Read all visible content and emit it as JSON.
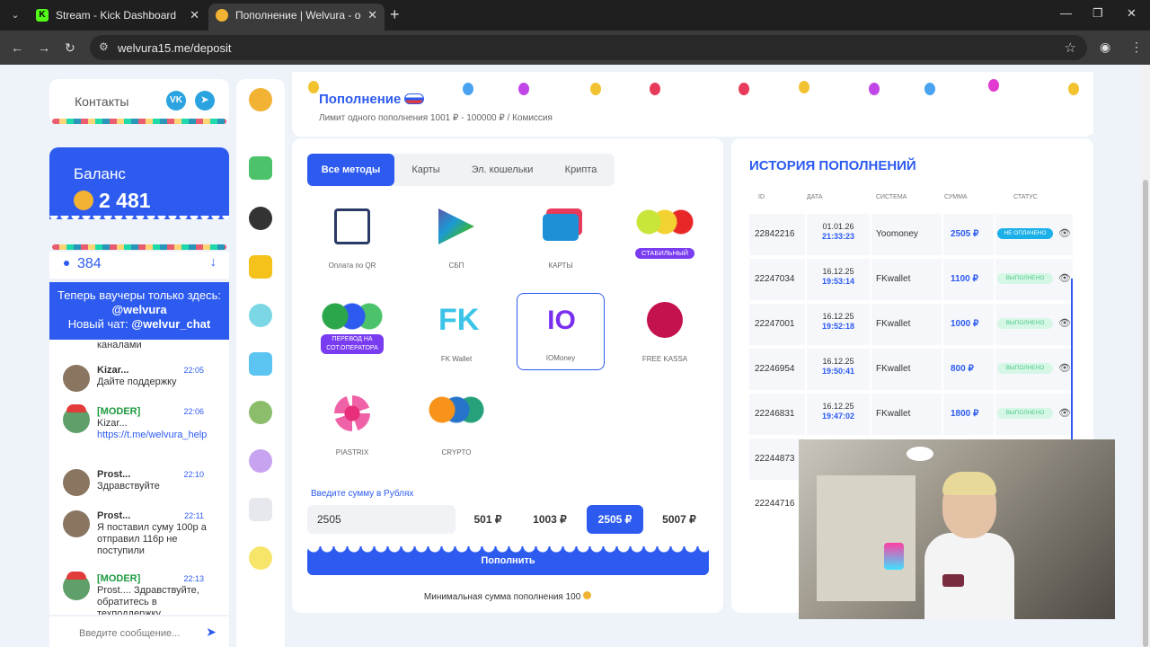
{
  "browser": {
    "tabs": [
      {
        "title": "Stream - Kick Dashboard",
        "favicon": "K"
      },
      {
        "title": "Пополнение | Welvura - офиц"
      }
    ],
    "url": "welvura15.me/deposit"
  },
  "sidebar": {
    "contacts_label": "Контакты",
    "social": [
      "VK",
      "➤"
    ],
    "balance_label": "Баланс",
    "balance_value": "2 481",
    "online_count": "384",
    "voucher_line1": "Теперь ваучеры только здесь:",
    "voucher_handle": "@welvura",
    "voucher_line2_prefix": "Новый чат:",
    "voucher_chat": "@welvur_chat"
  },
  "chat": {
    "truncated_text": "каналами",
    "messages": [
      {
        "name": "Kizar...",
        "time": "22:05",
        "text": "Дайте поддержку",
        "moder": false
      },
      {
        "name": "[MODER]",
        "time": "22:06",
        "text": "Kizar...",
        "link": "https://t.me/welvura_help",
        "moder": true
      },
      {
        "name": "Prost...",
        "time": "22:10",
        "text": "Здравствуйте",
        "moder": false
      },
      {
        "name": "Prost...",
        "time": "22:11",
        "text": "Я поставил суму 100р а отправил 116р не поступили",
        "moder": false
      },
      {
        "name": "[MODER]",
        "time": "22:13",
        "text": "Prost.... Здравствуйте, обратитесь в техподдержку",
        "moder": true
      }
    ],
    "input_placeholder": "Введите сообщение..."
  },
  "header": {
    "title": "Пополнение",
    "subtitle": "Лимит одного пополнения 1001 ₽ - 100000 ₽ / Комиссия"
  },
  "deposit": {
    "tabs": [
      "Все методы",
      "Карты",
      "Эл. кошельки",
      "Крипта"
    ],
    "methods": [
      {
        "label": "Оплата по QR"
      },
      {
        "label": "СБП"
      },
      {
        "label": "КАРТЫ"
      },
      {
        "label": "",
        "badge": "СТАБИЛЬНЫЙ"
      },
      {
        "label": "",
        "badge": "ПЕРЕВОД НА СОТ.ОПЕРАТОРА"
      },
      {
        "label": "FK Wallet"
      },
      {
        "label": "IOMoney"
      },
      {
        "label": "FREE KASSA"
      },
      {
        "label": "PIASTRIX"
      },
      {
        "label": "CRYPTO"
      }
    ],
    "amount_label": "Введите сумму в Рублях",
    "amount_value": "2505",
    "presets": [
      "501 ₽",
      "1003 ₽",
      "2505 ₽",
      "5007 ₽"
    ],
    "submit_label": "Пополнить",
    "min_note": "Минимальная сумма пополнения 100"
  },
  "history": {
    "title": "ИСТОРИЯ ПОПОЛНЕНИЙ",
    "columns": [
      "ID",
      "ДАТА",
      "СИСТЕМА",
      "СУММА",
      "СТАТУС"
    ],
    "rows": [
      {
        "id": "22842216",
        "date": "01.01.26",
        "time": "21:33:23",
        "system": "Yoomoney",
        "sum": "2505 ₽",
        "status": "НЕ ОПЛАЧЕНО",
        "paid": false
      },
      {
        "id": "22247034",
        "date": "16.12.25",
        "time": "19:53:14",
        "system": "FKwallet",
        "sum": "1100 ₽",
        "status": "ВЫПОЛНЕНО",
        "paid": true
      },
      {
        "id": "22247001",
        "date": "16.12.25",
        "time": "19:52:18",
        "system": "FKwallet",
        "sum": "1000 ₽",
        "status": "ВЫПОЛНЕНО",
        "paid": true
      },
      {
        "id": "22246954",
        "date": "16.12.25",
        "time": "19:50:41",
        "system": "FKwallet",
        "sum": "800 ₽",
        "status": "ВЫПОЛНЕНО",
        "paid": true
      },
      {
        "id": "22246831",
        "date": "16.12.25",
        "time": "19:47:02",
        "system": "FKwallet",
        "sum": "1800 ₽",
        "status": "ВЫПОЛНЕНО",
        "paid": true
      },
      {
        "id": "22244873"
      },
      {
        "id": "22244716"
      }
    ]
  },
  "colors": {
    "accent": "#2d5bf0",
    "unpaid": "#1cb0e8",
    "done_bg": "#d6f7e6",
    "done_fg": "#4ec98a",
    "badge": "#7a3cf0"
  }
}
